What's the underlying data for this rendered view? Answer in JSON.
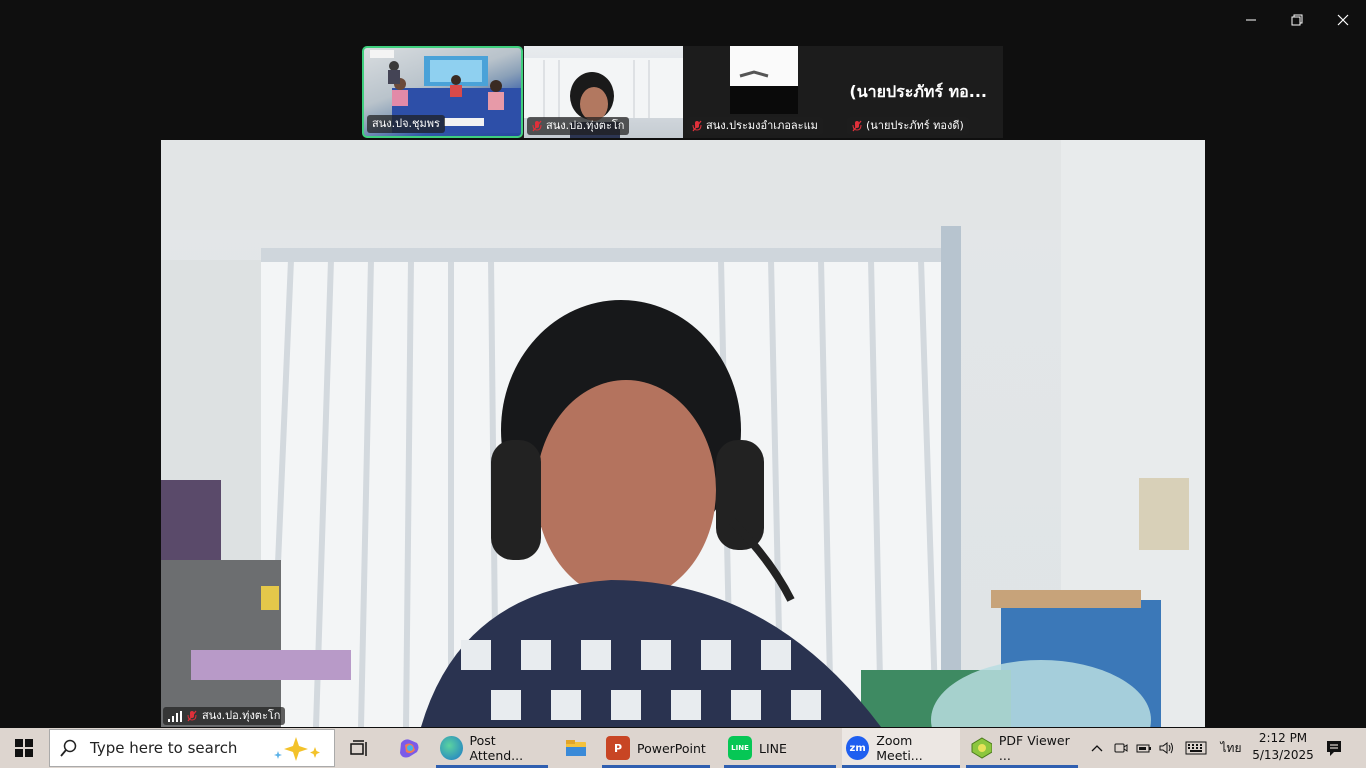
{
  "window": {
    "controls": [
      "minimize",
      "restore",
      "close"
    ]
  },
  "gallery": [
    {
      "name": "สนง.ปจ.ชุมพร",
      "active": true,
      "muted": false
    },
    {
      "name": "สนง.ปอ.ทุ่งตะโก",
      "muted": true
    },
    {
      "name": "สนง.ประมงอำเภอละแม",
      "muted": true
    },
    {
      "name": "(นายประภัทร์ ทองดี)",
      "muted": true,
      "display_name": "(นายประภัทร์ ทอ..."
    }
  ],
  "main_speaker": {
    "name": "สนง.ปอ.ทุ่งตะโก",
    "muted": true
  },
  "taskbar": {
    "search_placeholder": "Type here to search",
    "apps": [
      {
        "label": "Post Attend...",
        "icon": "edge-icon"
      },
      {
        "label": "",
        "icon": "file-explorer-icon"
      },
      {
        "label": "PowerPoint",
        "icon": "powerpoint-icon"
      },
      {
        "label": "LINE",
        "icon": "line-icon"
      },
      {
        "label": "Zoom Meeti...",
        "icon": "zoom-icon",
        "active": true
      },
      {
        "label": "PDF Viewer ...",
        "icon": "pdf-viewer-icon"
      }
    ],
    "language": "ไทย",
    "time": "2:12 PM",
    "date": "5/13/2025"
  },
  "colors": {
    "active_border": "#3fd07e",
    "taskbar_bg": "#ddd5cf",
    "mute_red": "#e0303a"
  }
}
